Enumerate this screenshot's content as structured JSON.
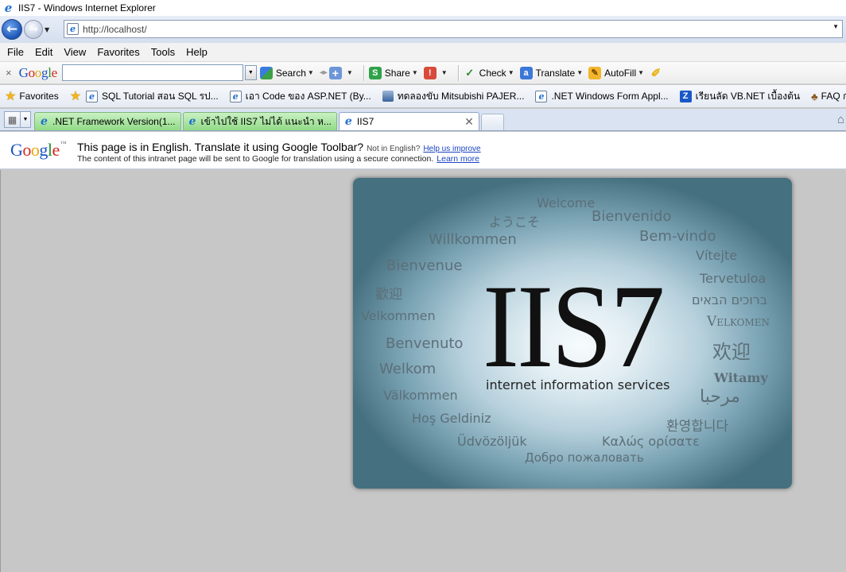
{
  "window": {
    "title": "IIS7 - Windows Internet Explorer"
  },
  "address": {
    "url": "http://localhost/"
  },
  "menu": [
    "File",
    "Edit",
    "View",
    "Favorites",
    "Tools",
    "Help"
  ],
  "google_toolbar": {
    "close": "×",
    "search_placeholder": "",
    "buttons": {
      "search": "Search",
      "share": "Share",
      "check": "Check",
      "translate": "Translate",
      "autofill": "AutoFill"
    }
  },
  "favorites": {
    "label": "Favorites",
    "items": [
      "SQL Tutorial สอน SQL รป...",
      "เอา Code ของ ASP.NET (By...",
      "ทดลองขับ Mitsubishi PAJER...",
      ".NET Windows Form Appl...",
      "เรียนลัด VB.NET เบื้องต้น",
      "FAQ การทำ In"
    ]
  },
  "tabs": [
    {
      "label": ".NET Framework Version(1...",
      "active": false
    },
    {
      "label": "เข้าไปใช้ IIS7 ไม่ได้ แนะนำ ห...",
      "active": false
    },
    {
      "label": "IIS7",
      "active": true
    }
  ],
  "translate_bar": {
    "logo": "Google",
    "tm": "™",
    "line1": "This page is in English.  Translate it using Google Toolbar?",
    "not_english": "Not in English?",
    "help_link": "Help us improve",
    "line2": "The content of this intranet page will be sent to Google for translation using a secure connection.",
    "learn_link": "Learn more"
  },
  "iis_page": {
    "logo_text": "IIS7",
    "subtitle": "internet information services",
    "words": {
      "welcome": "Welcome",
      "youkoso": "ようこそ",
      "bienvenido": "Bienvenido",
      "willkommen": "Willkommen",
      "bemvindo": "Bem-vindo",
      "vitejte": "Vítejte",
      "bienvenue": "Bienvenue",
      "tervetuloa": "Tervetuloa",
      "huanying_tc": "歡迎",
      "hebrew": "ברוכים הבאים",
      "velkommen": "Velkommen",
      "velkomen": "Velkomen",
      "huanying_sc": "欢迎",
      "benvenuto": "Benvenuto",
      "welkom": "Welkom",
      "witamy": "Witamy",
      "valkommen": "Välkommen",
      "arabic": "مرحبا",
      "hos_geldiniz": "Hoş Geldiniz",
      "korean": "환영합니다",
      "udvozoljuk": "Üdvözöljük",
      "greek": "Καλώς ορίσατε",
      "russian": "Добро пожаловать"
    }
  }
}
